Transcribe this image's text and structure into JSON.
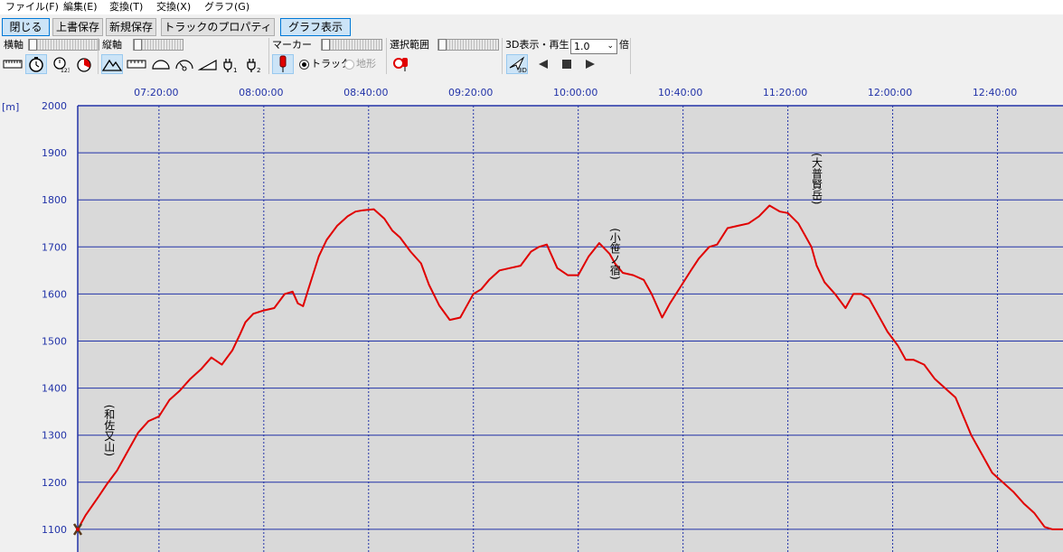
{
  "menu": [
    {
      "label": "ファイル(F)"
    },
    {
      "label": "編集(E)"
    },
    {
      "label": "変換(T)"
    },
    {
      "label": "交換(X)"
    },
    {
      "label": "グラフ(G)"
    }
  ],
  "buttons": {
    "close": "閉じる",
    "overwrite_save": "上書保存",
    "new_save": "新規保存",
    "track_properties": "トラックのプロパティ",
    "graph_display": "グラフ表示"
  },
  "toolbar": {
    "horizontal_axis_label": "横軸",
    "vertical_axis_label": "縦軸",
    "marker_label": "マーカー",
    "selection_range_label": "選択範囲",
    "playback_label": "3D表示・再生",
    "speed_value": "1.0",
    "speed_unit": "倍",
    "radio_track": "トラック",
    "radio_terrain": "地形",
    "radio_track_selected": true,
    "icons": {
      "h_distance": "ruler-icon",
      "h_time": "clock-icon",
      "h_count": "count-clock-icon",
      "h_elapsed": "red-clock-icon",
      "v_elevation": "mountain-icon",
      "v_speed": "speed-icon",
      "marker": "pin-icon",
      "selection": "select-marker-icon",
      "three_d": "3d-flight-icon",
      "prev": "play-back-icon",
      "stop": "stop-icon",
      "play": "play-icon"
    }
  },
  "chart_data": {
    "type": "line",
    "ylabel": "[m]",
    "ylim": [
      1000,
      2000
    ],
    "yticks": [
      "2000",
      "1900",
      "1800",
      "1700",
      "1600",
      "1500",
      "1400",
      "1300",
      "1200",
      "1100",
      "1000"
    ],
    "xticks": [
      "07:20:00",
      "08:00:00",
      "08:40:00",
      "09:20:00",
      "10:00:00",
      "10:40:00",
      "11:20:00",
      "12:00:00",
      "12:40:00"
    ],
    "xlim": [
      "06:49:00",
      "13:05:00"
    ],
    "grid": true,
    "line_color": "#e00000",
    "series": [
      {
        "x": [
          "06:49",
          "06:52",
          "06:57",
          "07:00",
          "07:04",
          "07:08",
          "07:12",
          "07:16",
          "07:20",
          "07:24",
          "07:28",
          "07:32",
          "07:36",
          "07:40",
          "07:44",
          "07:48",
          "07:51",
          "07:53",
          "07:56",
          "08:00",
          "08:04",
          "08:08",
          "08:11",
          "08:13",
          "08:15",
          "08:17",
          "08:19",
          "08:21",
          "08:24",
          "08:28",
          "08:32",
          "08:35",
          "08:38",
          "08:42",
          "08:46",
          "08:49",
          "08:52",
          "08:56",
          "09:00",
          "09:03",
          "09:07",
          "09:11",
          "09:15",
          "09:18",
          "09:20",
          "09:23",
          "09:26",
          "09:30",
          "09:34",
          "09:38",
          "09:42",
          "09:45",
          "09:48",
          "09:52",
          "09:56",
          "10:00",
          "10:04",
          "10:08",
          "10:12",
          "10:14",
          "10:17",
          "10:21",
          "10:25",
          "10:28",
          "10:32",
          "10:35",
          "10:39",
          "10:43",
          "10:46",
          "10:50",
          "10:53",
          "10:57",
          "11:01",
          "11:05",
          "11:09",
          "11:13",
          "11:17",
          "11:20",
          "11:24",
          "11:27",
          "11:29",
          "11:31",
          "11:34",
          "11:38",
          "11:42",
          "11:45",
          "11:48",
          "11:51",
          "11:54",
          "11:58",
          "12:02",
          "12:05",
          "12:08",
          "12:12",
          "12:16",
          "12:20",
          "12:24",
          "12:27",
          "12:30",
          "12:34",
          "12:38",
          "12:42",
          "12:46",
          "12:50",
          "12:54",
          "12:58",
          "13:01",
          "13:05"
        ],
        "y": [
          1100,
          1130,
          1170,
          1195,
          1225,
          1265,
          1305,
          1330,
          1340,
          1375,
          1395,
          1420,
          1440,
          1465,
          1450,
          1480,
          1515,
          1540,
          1558,
          1565,
          1570,
          1600,
          1605,
          1580,
          1574,
          1610,
          1645,
          1680,
          1715,
          1745,
          1765,
          1775,
          1778,
          1780,
          1760,
          1735,
          1720,
          1690,
          1665,
          1620,
          1575,
          1545,
          1550,
          1580,
          1600,
          1610,
          1630,
          1650,
          1655,
          1660,
          1690,
          1700,
          1705,
          1655,
          1640,
          1640,
          1680,
          1708,
          1685,
          1665,
          1645,
          1640,
          1630,
          1600,
          1550,
          1580,
          1615,
          1650,
          1675,
          1700,
          1705,
          1740,
          1745,
          1750,
          1765,
          1788,
          1775,
          1772,
          1750,
          1720,
          1700,
          1660,
          1625,
          1600,
          1570,
          1600,
          1600,
          1590,
          1560,
          1520,
          1490,
          1460,
          1460,
          1450,
          1420,
          1400,
          1380,
          1340,
          1300,
          1260,
          1220,
          1200,
          1180,
          1155,
          1135,
          1105,
          1100,
          1100
        ]
      }
    ],
    "annotations": [
      {
        "text": "(和佐又山)",
        "x": "07:01",
        "y": 1310
      },
      {
        "text": "(小笹ノ宿)",
        "x": "10:14",
        "y": 1685
      },
      {
        "text": "(大普賢岳)",
        "x": "11:31",
        "y": 1845
      }
    ]
  }
}
